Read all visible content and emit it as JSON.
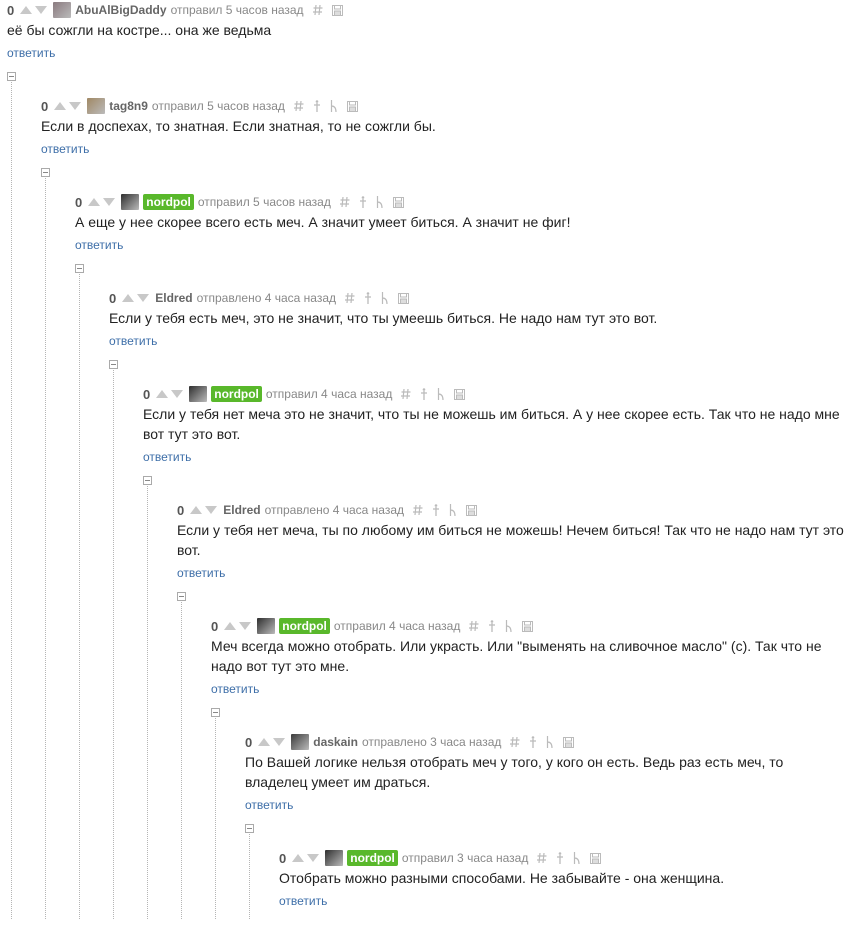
{
  "ui": {
    "reply_label": "ответить"
  },
  "comments": [
    {
      "rating": "0",
      "author": "AbuAlBigDaddy",
      "badge": false,
      "posted": "отправил 5 часов назад",
      "avatar_color": "#8a7a7f",
      "actions": [
        "hash-icon",
        "save-icon"
      ],
      "text": "её бы сожгли на костре... она же ведьма"
    },
    {
      "rating": "0",
      "author": "tag8n9",
      "badge": false,
      "posted": "отправил 5 часов назад",
      "avatar_color": "#a08864",
      "actions": [
        "hash-icon",
        "dagger-icon",
        "branch-icon",
        "save-icon"
      ],
      "text": "Если в доспехах, то знатная. Если знатная, то не сожгли бы."
    },
    {
      "rating": "0",
      "author": "nordpol",
      "badge": true,
      "posted": "отправил 5 часов назад",
      "avatar_color": "#2e2e2e",
      "actions": [
        "hash-icon",
        "dagger-icon",
        "branch-icon",
        "save-icon"
      ],
      "text": "А еще у нее скорее всего есть меч. А значит умеет биться. А значит не фиг!"
    },
    {
      "rating": "0",
      "author": "Eldred",
      "badge": false,
      "posted": "отправлено 4 часа назад",
      "avatar_color": "",
      "actions": [
        "hash-icon",
        "dagger-icon",
        "branch-icon",
        "save-icon"
      ],
      "text": "Если у тебя есть меч, это не значит, что ты умеешь биться. Не надо нам тут это вот."
    },
    {
      "rating": "0",
      "author": "nordpol",
      "badge": true,
      "posted": "отправил 4 часа назад",
      "avatar_color": "#2e2e2e",
      "actions": [
        "hash-icon",
        "dagger-icon",
        "branch-icon",
        "save-icon"
      ],
      "text": "Если у тебя нет меча это не значит, что ты не можешь им биться. А у нее скорее есть. Так что не надо мне вот тут это вот."
    },
    {
      "rating": "0",
      "author": "Eldred",
      "badge": false,
      "posted": "отправлено 4 часа назад",
      "avatar_color": "",
      "actions": [
        "hash-icon",
        "dagger-icon",
        "branch-icon",
        "save-icon"
      ],
      "text": "Если у тебя нет меча, ты по любому им биться не можешь! Нечем биться! Так что не надо нам тут это вот."
    },
    {
      "rating": "0",
      "author": "nordpol",
      "badge": true,
      "posted": "отправил 4 часа назад",
      "avatar_color": "#2e2e2e",
      "actions": [
        "hash-icon",
        "dagger-icon",
        "branch-icon",
        "save-icon"
      ],
      "text": "Меч всегда можно отобрать. Или украсть. Или \"выменять на сливочное масло\" (с). Так что не надо вот тут это мне."
    },
    {
      "rating": "0",
      "author": "daskain",
      "badge": false,
      "posted": "отправлено 3 часа назад",
      "avatar_color": "#3a3a3a",
      "actions": [
        "hash-icon",
        "dagger-icon",
        "branch-icon",
        "save-icon"
      ],
      "text": "По Вашей логике нельзя отобрать меч у того, у кого он есть. Ведь раз есть меч, то владелец умеет им драться."
    },
    {
      "rating": "0",
      "author": "nordpol",
      "badge": true,
      "posted": "отправил 3 часа назад",
      "avatar_color": "#2e2e2e",
      "actions": [
        "hash-icon",
        "dagger-icon",
        "branch-icon",
        "save-icon"
      ],
      "text": "Отобрать можно разными способами. Не забывайте - она женщина."
    }
  ]
}
